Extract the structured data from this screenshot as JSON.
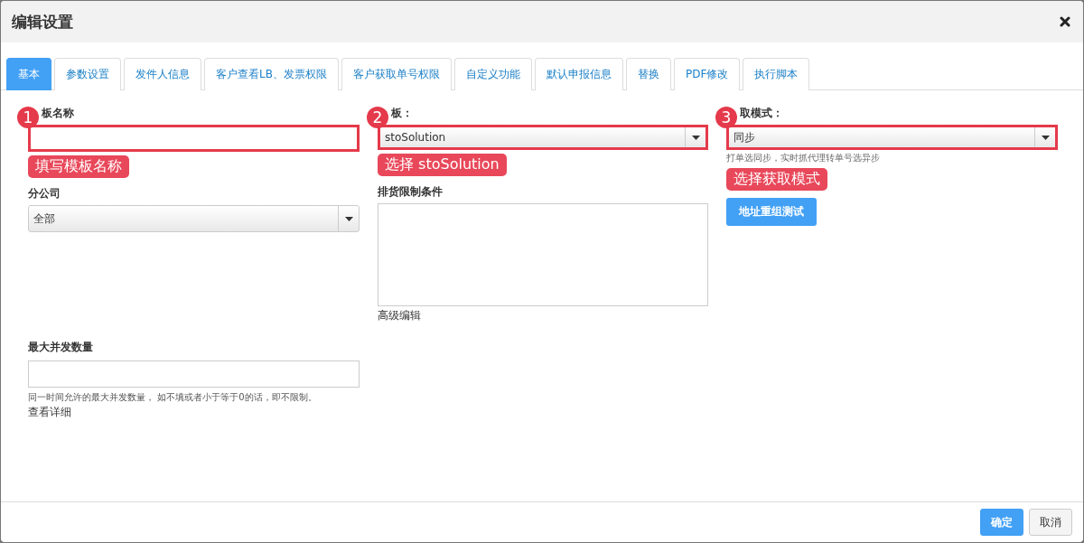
{
  "dialog": {
    "title": "编辑设置"
  },
  "tabs": [
    {
      "label": "基本",
      "selected": true
    },
    {
      "label": "参数设置",
      "selected": false
    },
    {
      "label": "发件人信息",
      "selected": false
    },
    {
      "label": "客户查看LB、发票权限",
      "selected": false
    },
    {
      "label": "客户获取单号权限",
      "selected": false
    },
    {
      "label": "自定义功能",
      "selected": false
    },
    {
      "label": "默认申报信息",
      "selected": false
    },
    {
      "label": "替换",
      "selected": false
    },
    {
      "label": "PDF修改",
      "selected": false
    },
    {
      "label": "执行脚本",
      "selected": false
    }
  ],
  "columns": [
    {
      "fields": [
        {
          "kind": "input",
          "label": "板名称",
          "annotation": {
            "number": "1",
            "text": "填写模板名称"
          }
        },
        {
          "kind": "select",
          "label": "分公司",
          "value": "全部"
        }
      ]
    },
    {
      "fields": [
        {
          "kind": "select",
          "label": "板：",
          "value": "stoSolution",
          "annotation": {
            "number": "2",
            "text": "选择 stoSolution"
          }
        },
        {
          "kind": "textarea",
          "label": "排货限制条件",
          "link": "高级编辑"
        }
      ]
    },
    {
      "fields": [
        {
          "kind": "select",
          "label": "取模式：",
          "value": "同步",
          "hint": "打单选同步，实时抓代理转单号选异步",
          "annotation": {
            "number": "3",
            "text": "选择获取模式"
          }
        },
        {
          "kind": "button",
          "label": "地址重组测试"
        }
      ]
    }
  ],
  "extra_fields": [
    {
      "kind": "input",
      "label": "最大并发数量",
      "hint": "同一时间允许的最大并发数量， 如不填或者小于等于0的话，即不限制。",
      "link": "查看详细"
    }
  ],
  "footer_buttons": [
    {
      "label": "确定",
      "kind": "primary"
    },
    {
      "label": "取消",
      "kind": "default"
    }
  ]
}
